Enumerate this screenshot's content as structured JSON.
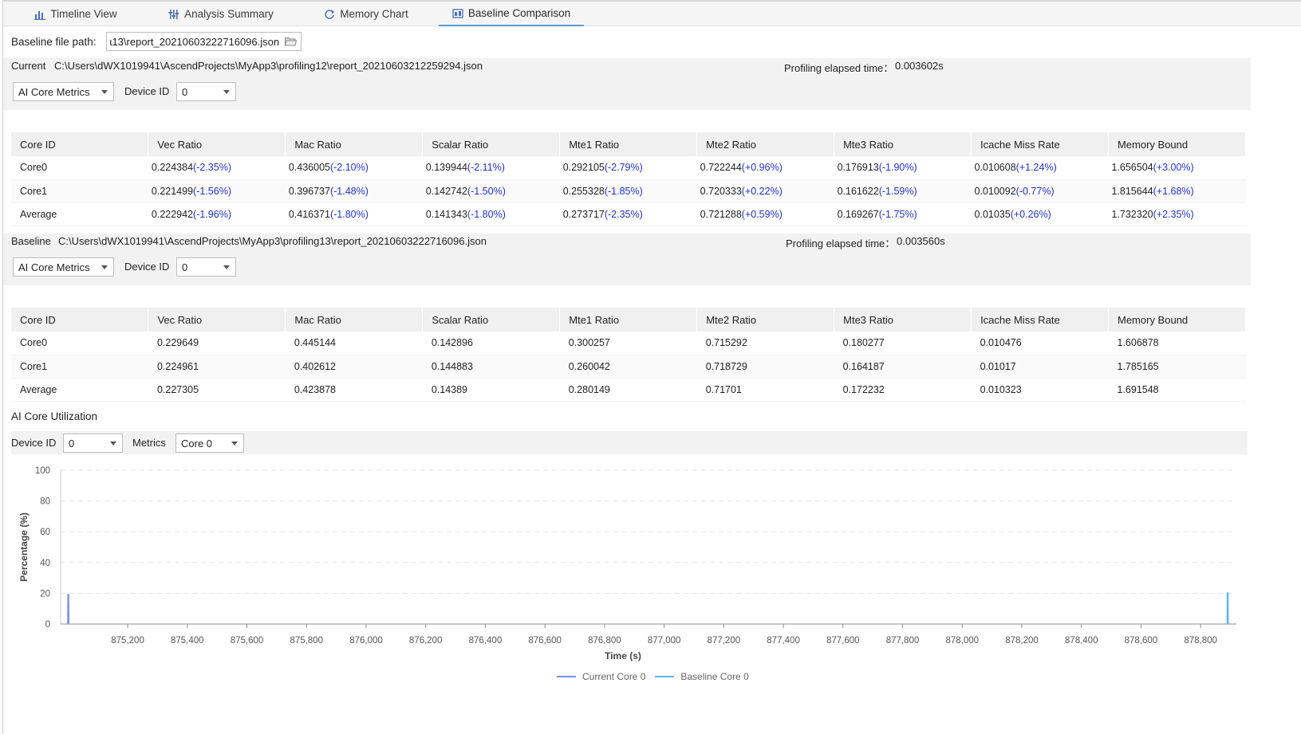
{
  "tabs": [
    {
      "label": "Timeline View",
      "icon": "bar-chart-icon",
      "active": false
    },
    {
      "label": "Analysis Summary",
      "icon": "sliders-icon",
      "active": false
    },
    {
      "label": "Memory Chart",
      "icon": "refresh-icon",
      "active": false
    },
    {
      "label": "Baseline Comparison",
      "icon": "compare-icon",
      "active": true
    }
  ],
  "baseline_path": {
    "label": "Baseline file path:",
    "value": "ɩ13\\report_20210603222716096.json"
  },
  "current": {
    "label": "Current",
    "path": "C:\\Users\\dWX1019941\\AscendProjects\\MyApp3\\profiling12\\report_20210603212259294.json",
    "elapsed_label": "Profiling elapsed time：",
    "elapsed_value": "0.003602s",
    "metrics_select": "AI Core Metrics",
    "device_label": "Device ID",
    "device_value": "0",
    "headers": [
      "Core ID",
      "Vec Ratio",
      "Mac Ratio",
      "Scalar Ratio",
      "Mte1 Ratio",
      "Mte2 Ratio",
      "Mte3 Ratio",
      "Icache Miss Rate",
      "Memory Bound"
    ],
    "rows": [
      {
        "id": "Core0",
        "cells": [
          [
            "0.224384",
            "(-2.35%)"
          ],
          [
            "0.436005",
            "(-2.10%)"
          ],
          [
            "0.139944",
            "(-2.11%)"
          ],
          [
            "0.292105",
            "(-2.79%)"
          ],
          [
            "0.722244",
            "(+0.96%)"
          ],
          [
            "0.176913",
            "(-1.90%)"
          ],
          [
            "0.010608",
            "(+1.24%)"
          ],
          [
            "1.656504",
            "(+3.00%)"
          ]
        ]
      },
      {
        "id": "Core1",
        "cells": [
          [
            "0.221499",
            "(-1.56%)"
          ],
          [
            "0.396737",
            "(-1.48%)"
          ],
          [
            "0.142742",
            "(-1.50%)"
          ],
          [
            "0.255328",
            "(-1.85%)"
          ],
          [
            "0.720333",
            "(+0.22%)"
          ],
          [
            "0.161622",
            "(-1.59%)"
          ],
          [
            "0.010092",
            "(-0.77%)"
          ],
          [
            "1.815644",
            "(+1.68%)"
          ]
        ]
      },
      {
        "id": "Average",
        "cells": [
          [
            "0.222942",
            "(-1.96%)"
          ],
          [
            "0.416371",
            "(-1.80%)"
          ],
          [
            "0.141343",
            "(-1.80%)"
          ],
          [
            "0.273717",
            "(-2.35%)"
          ],
          [
            "0.721288",
            "(+0.59%)"
          ],
          [
            "0.169267",
            "(-1.75%)"
          ],
          [
            "0.01035",
            "(+0.26%)"
          ],
          [
            "1.732320",
            "(+2.35%)"
          ]
        ]
      }
    ]
  },
  "baseline": {
    "label": "Baseline",
    "path": "C:\\Users\\dWX1019941\\AscendProjects\\MyApp3\\profiling13\\report_20210603222716096.json",
    "elapsed_label": "Profiling elapsed time：",
    "elapsed_value": "0.003560s",
    "metrics_select": "AI Core Metrics",
    "device_label": "Device ID",
    "device_value": "0",
    "headers": [
      "Core ID",
      "Vec Ratio",
      "Mac Ratio",
      "Scalar Ratio",
      "Mte1 Ratio",
      "Mte2 Ratio",
      "Mte3 Ratio",
      "Icache Miss Rate",
      "Memory Bound"
    ],
    "rows": [
      {
        "id": "Core0",
        "cells": [
          "0.229649",
          "0.445144",
          "0.142896",
          "0.300257",
          "0.715292",
          "0.180277",
          "0.010476",
          "1.606878"
        ]
      },
      {
        "id": "Core1",
        "cells": [
          "0.224961",
          "0.402612",
          "0.144883",
          "0.260042",
          "0.718729",
          "0.164187",
          "0.01017",
          "1.785165"
        ]
      },
      {
        "id": "Average",
        "cells": [
          "0.227305",
          "0.423878",
          "0.14389",
          "0.280149",
          "0.71701",
          "0.172232",
          "0.010323",
          "1.691548"
        ]
      }
    ]
  },
  "utilization": {
    "title": "AI Core Utilization",
    "device_label": "Device ID",
    "device_value": "0",
    "metrics_label": "Metrics",
    "metrics_value": "Core 0"
  },
  "chart_data": {
    "type": "line",
    "xlabel": "Time (s)",
    "ylabel": "Percentage (%)",
    "ylim": [
      0,
      100
    ],
    "yticks": [
      0,
      20,
      40,
      60,
      80,
      100
    ],
    "xlim": [
      874975,
      878920
    ],
    "xticks": [
      875200,
      875400,
      875600,
      875800,
      876000,
      876200,
      876400,
      876600,
      876800,
      877000,
      877200,
      877400,
      877600,
      877800,
      878000,
      878200,
      878400,
      878600,
      878800
    ],
    "xtick_labels": [
      "875,200",
      "875,400",
      "875,600",
      "875,800",
      "876,000",
      "876,200",
      "876,400",
      "876,600",
      "876,800",
      "877,000",
      "877,200",
      "877,400",
      "877,600",
      "877,800",
      "878,000",
      "878,200",
      "878,400",
      "878,600",
      "878,800"
    ],
    "grid": true,
    "legend_position": "bottom-center",
    "series": [
      {
        "name": "Current Core 0",
        "color": "#7b8fe6",
        "x": [
          875000,
          875000.5,
          875001,
          875001.5
        ],
        "y": [
          0,
          19,
          19,
          0
        ]
      },
      {
        "name": "Baseline Core 0",
        "color": "#5fb6f0",
        "x": [
          878890,
          878890.5,
          878891,
          878891.5
        ],
        "y": [
          0,
          20,
          20,
          0
        ]
      }
    ]
  }
}
